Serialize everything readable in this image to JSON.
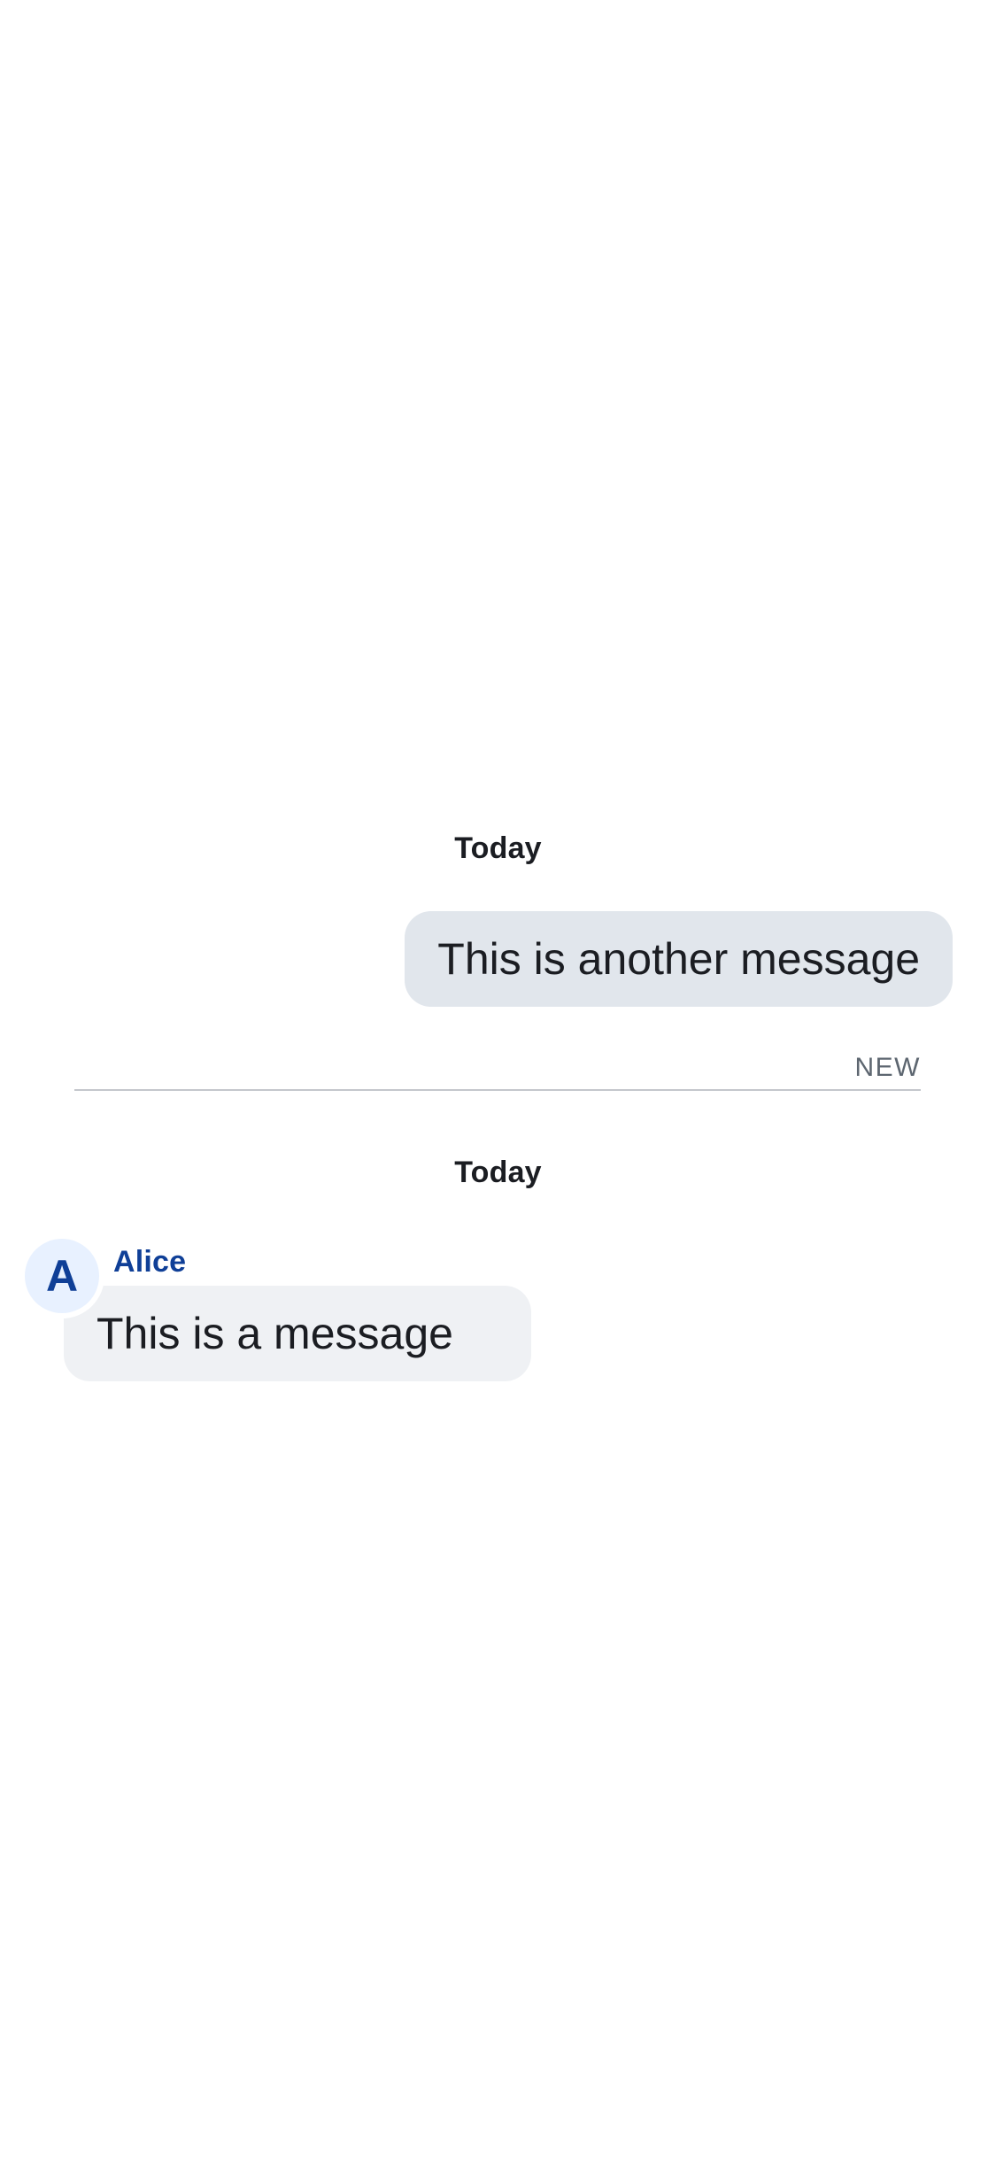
{
  "timeline": {
    "first_date_label": "Today",
    "outgoing_message": "This is another message",
    "new_marker_label": "NEW",
    "second_date_label": "Today",
    "incoming": {
      "avatar_initial": "A",
      "sender_name": "Alice",
      "message": "This is a message"
    }
  },
  "colors": {
    "outgoing_bubble": "#e1e6ec",
    "incoming_bubble": "#eff1f4",
    "accent_blue": "#0f3f97",
    "avatar_background": "#e8f1ff",
    "new_label": "#5d6670"
  }
}
